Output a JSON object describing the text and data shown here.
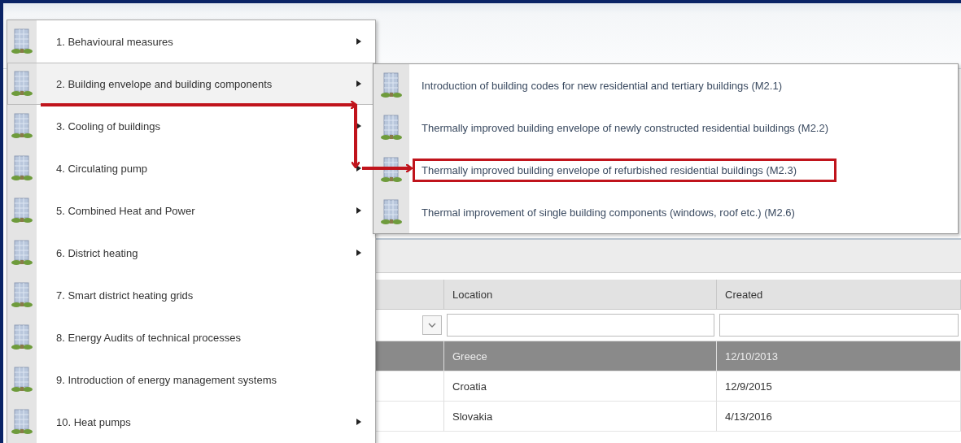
{
  "main_menu": {
    "items": [
      {
        "label": "1. Behavioural measures",
        "has_submenu": true,
        "selected": false
      },
      {
        "label": "2. Building envelope and building components",
        "has_submenu": true,
        "selected": true
      },
      {
        "label": "3. Cooling of buildings",
        "has_submenu": true,
        "selected": false
      },
      {
        "label": "4. Circulating pump",
        "has_submenu": true,
        "selected": false
      },
      {
        "label": "5. Combined Heat and Power",
        "has_submenu": true,
        "selected": false
      },
      {
        "label": "6. District heating",
        "has_submenu": true,
        "selected": false
      },
      {
        "label": "7. Smart district heating grids",
        "has_submenu": false,
        "selected": false
      },
      {
        "label": "8. Energy Audits of technical processes",
        "has_submenu": false,
        "selected": false
      },
      {
        "label": "9. Introduction of energy management systems",
        "has_submenu": false,
        "selected": false
      },
      {
        "label": "10. Heat pumps",
        "has_submenu": true,
        "selected": false
      }
    ]
  },
  "submenu": {
    "items": [
      {
        "label": "Introduction of building codes for new residential and tertiary buildings (M2.1)",
        "highlighted": false
      },
      {
        "label": "Thermally improved building envelope of newly constructed residential buildings (M2.2)",
        "highlighted": false
      },
      {
        "label": "Thermally improved building envelope of refurbished residential buildings (M2.3)",
        "highlighted": true
      },
      {
        "label": "Thermal improvement of single building components (windows, roof etc.) (M2.6)",
        "highlighted": false
      }
    ]
  },
  "table": {
    "columns": [
      {
        "label": "Location"
      },
      {
        "label": "Created"
      }
    ],
    "rows": [
      {
        "location": "Greece",
        "created": "12/10/2013",
        "selected": true
      },
      {
        "location": "Croatia",
        "created": "12/9/2015",
        "selected": false
      },
      {
        "location": "Slovakia",
        "created": "4/13/2016",
        "selected": false
      }
    ]
  }
}
